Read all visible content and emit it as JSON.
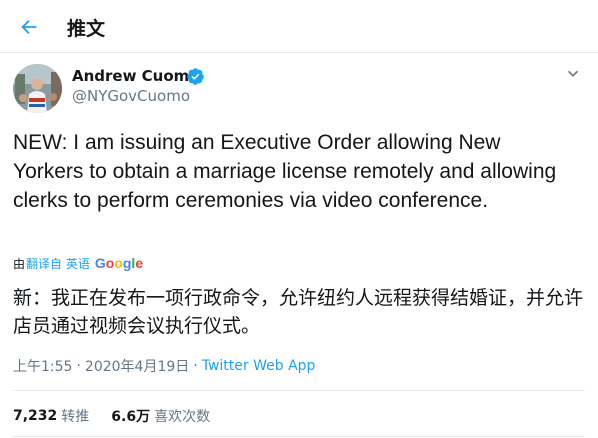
{
  "header": {
    "title": "推文",
    "back_icon": "arrow-left-icon"
  },
  "author": {
    "name": "Andrew Cuomo",
    "handle": "@NYGovCuomo",
    "verified_icon": "verified-badge-icon",
    "more_icon": "chevron-down-icon"
  },
  "tweet": {
    "text": "NEW: I am issuing an Executive Order allowing New Yorkers to obtain a marriage license remotely and allowing clerks to perform ceremonies via video conference."
  },
  "translation": {
    "by_label": "由",
    "link_label": "翻译自 英语",
    "provider": "Google",
    "text": "新：我正在发布一项行政命令，允许纽约人远程获得结婚证，并允许店员通过视频会议执行仪式。"
  },
  "meta": {
    "time": "上午1:55",
    "dot1": "·",
    "date": "2020年4月19日",
    "dot2": "·",
    "source": "Twitter Web App"
  },
  "stats": {
    "retweets_count": "7,232",
    "retweets_label": "转推",
    "likes_count": "6.6万",
    "likes_label": "喜欢次数"
  },
  "colors": {
    "accent": "#1da1f2",
    "text": "#14171a",
    "muted": "#657786",
    "border": "#e6ecf0"
  }
}
